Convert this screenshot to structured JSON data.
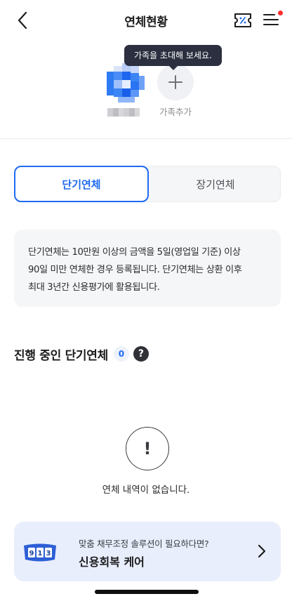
{
  "header": {
    "title": "연체현황"
  },
  "family": {
    "tooltip": "가족을 초대해 보세요.",
    "add_label": "가족추가"
  },
  "tabs": [
    {
      "label": "단기연체",
      "active": true
    },
    {
      "label": "장기연체",
      "active": false
    }
  ],
  "info": {
    "lines": [
      "단기연체는 10만원 이상의 금액을 5일(영업일 기준) 이상",
      "90일 미만 연체한 경우 등록됩니다. 단기연체는 상환 이후",
      "최대 3년간 신용평가에 활용됩니다."
    ]
  },
  "section": {
    "title": "진행 중인 단기연체",
    "count": "0",
    "help": "?"
  },
  "empty": {
    "icon": "!",
    "text": "연체 내역이 없습니다."
  },
  "promo": {
    "subtitle": "맞춤 채무조정 솔루션이 필요하다면?",
    "title": "신용회복 케어",
    "illust_digits": [
      "9",
      "1",
      "3"
    ]
  },
  "colors": {
    "accent": "#1f6bf0",
    "notification_dot": "#ff2d2d",
    "tooltip_bg": "#2b2f3f",
    "banner_bg": "#e8eefc"
  }
}
